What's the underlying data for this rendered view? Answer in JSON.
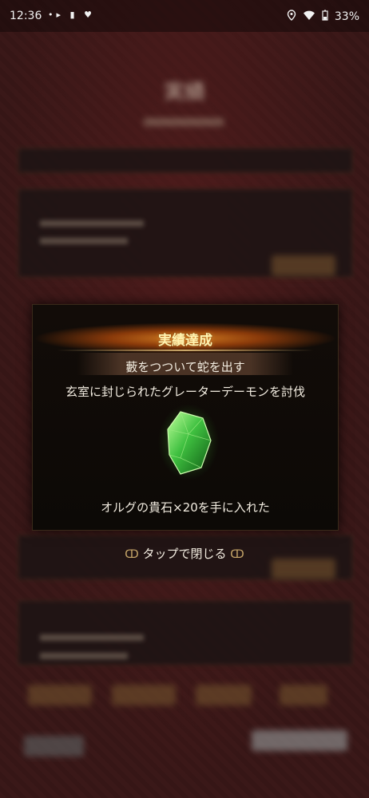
{
  "status_bar": {
    "time": "12:36",
    "left_icons": [
      "notification-dots-icon",
      "battery-saver-icon",
      "heart-icon"
    ],
    "right_icons": [
      "location-icon",
      "wifi-icon",
      "battery-icon"
    ],
    "battery": "33%"
  },
  "background": {
    "title": "実績"
  },
  "modal": {
    "title": "実績達成",
    "achievement_name": "藪をつついて蛇を出す",
    "achievement_desc": "玄室に封じられたグレーターデーモンを討伐",
    "reward_icon": "green-gem-icon",
    "reward_text": "オルグの貴石×20を手に入れた"
  },
  "close_hint": {
    "text": "タップで閉じる",
    "left_ornament": "ornament-left-icon",
    "right_ornament": "ornament-right-icon"
  },
  "colors": {
    "title_glow": "#d07a20",
    "gem_green": "#3fc040",
    "text": "#f2ece0",
    "gold": "#c9a86a"
  }
}
